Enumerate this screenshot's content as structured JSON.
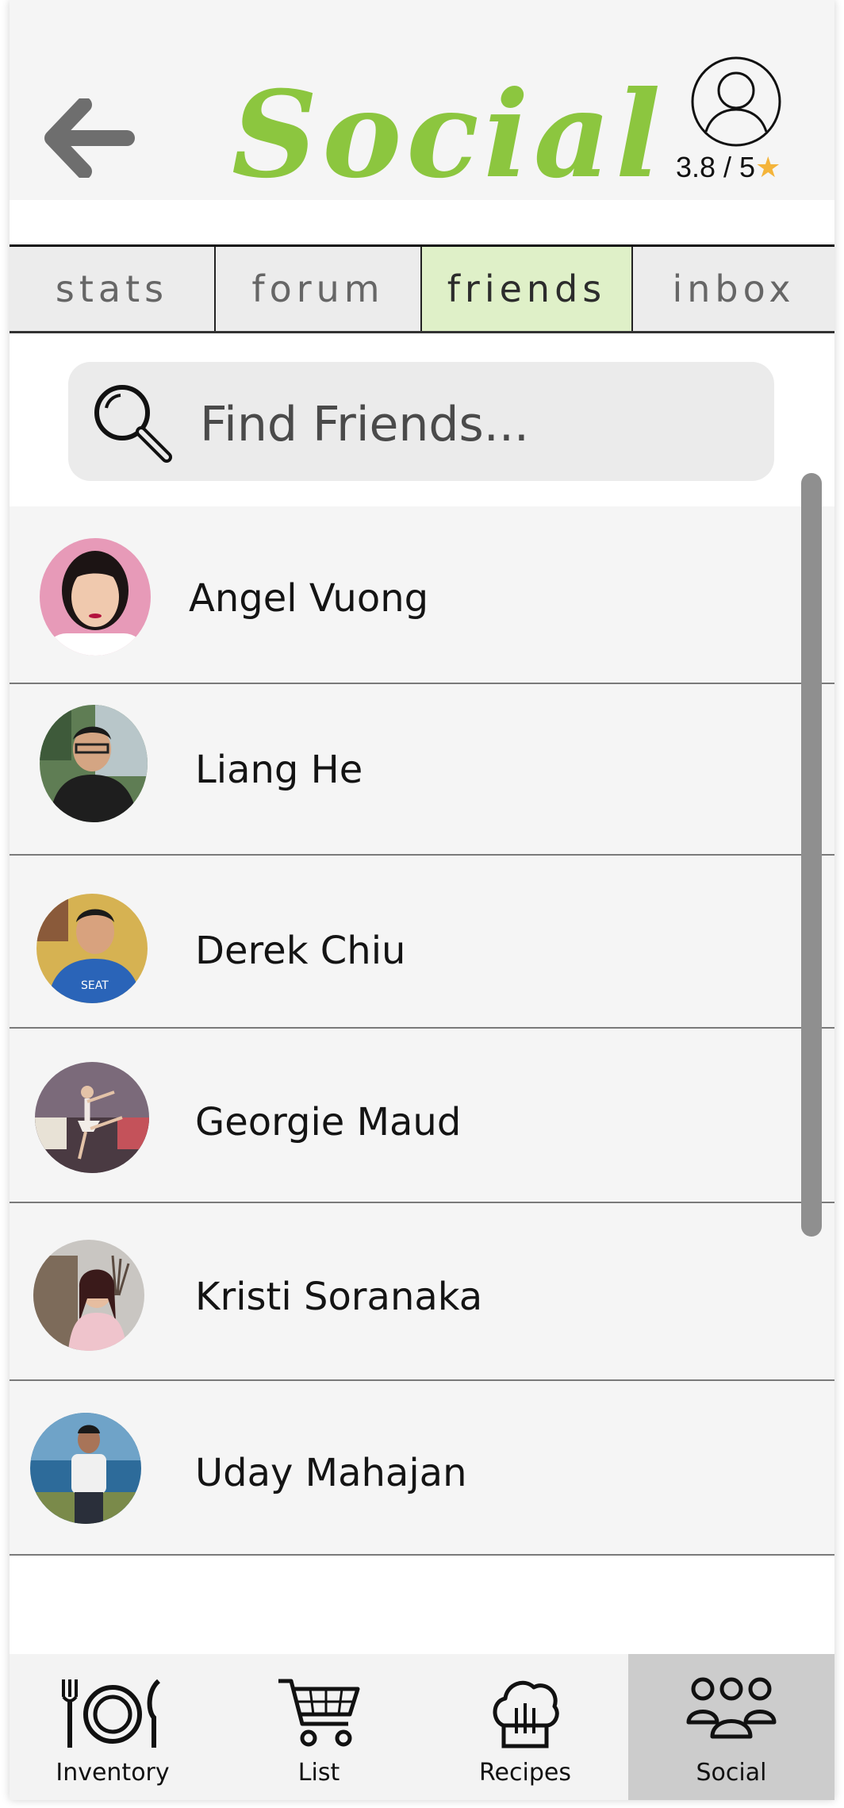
{
  "header": {
    "title": "Social",
    "rating": "3.8 / 5",
    "rating_star": "★",
    "accent_color": "#8cc63f"
  },
  "tabs": [
    {
      "label": "stats",
      "active": false
    },
    {
      "label": "forum",
      "active": false
    },
    {
      "label": "friends",
      "active": true
    },
    {
      "label": "inbox",
      "active": false
    }
  ],
  "search": {
    "placeholder": "Find Friends..."
  },
  "friends": [
    {
      "name": "Angel Vuong"
    },
    {
      "name": "Liang He"
    },
    {
      "name": "Derek Chiu"
    },
    {
      "name": "Georgie Maud"
    },
    {
      "name": "Kristi Soranaka"
    },
    {
      "name": "Uday Mahajan"
    }
  ],
  "nav": [
    {
      "label": "Inventory",
      "icon": "plate-cutlery-icon",
      "active": false
    },
    {
      "label": "List",
      "icon": "cart-icon",
      "active": false
    },
    {
      "label": "Recipes",
      "icon": "chef-hat-icon",
      "active": false
    },
    {
      "label": "Social",
      "icon": "people-icon",
      "active": true
    }
  ]
}
